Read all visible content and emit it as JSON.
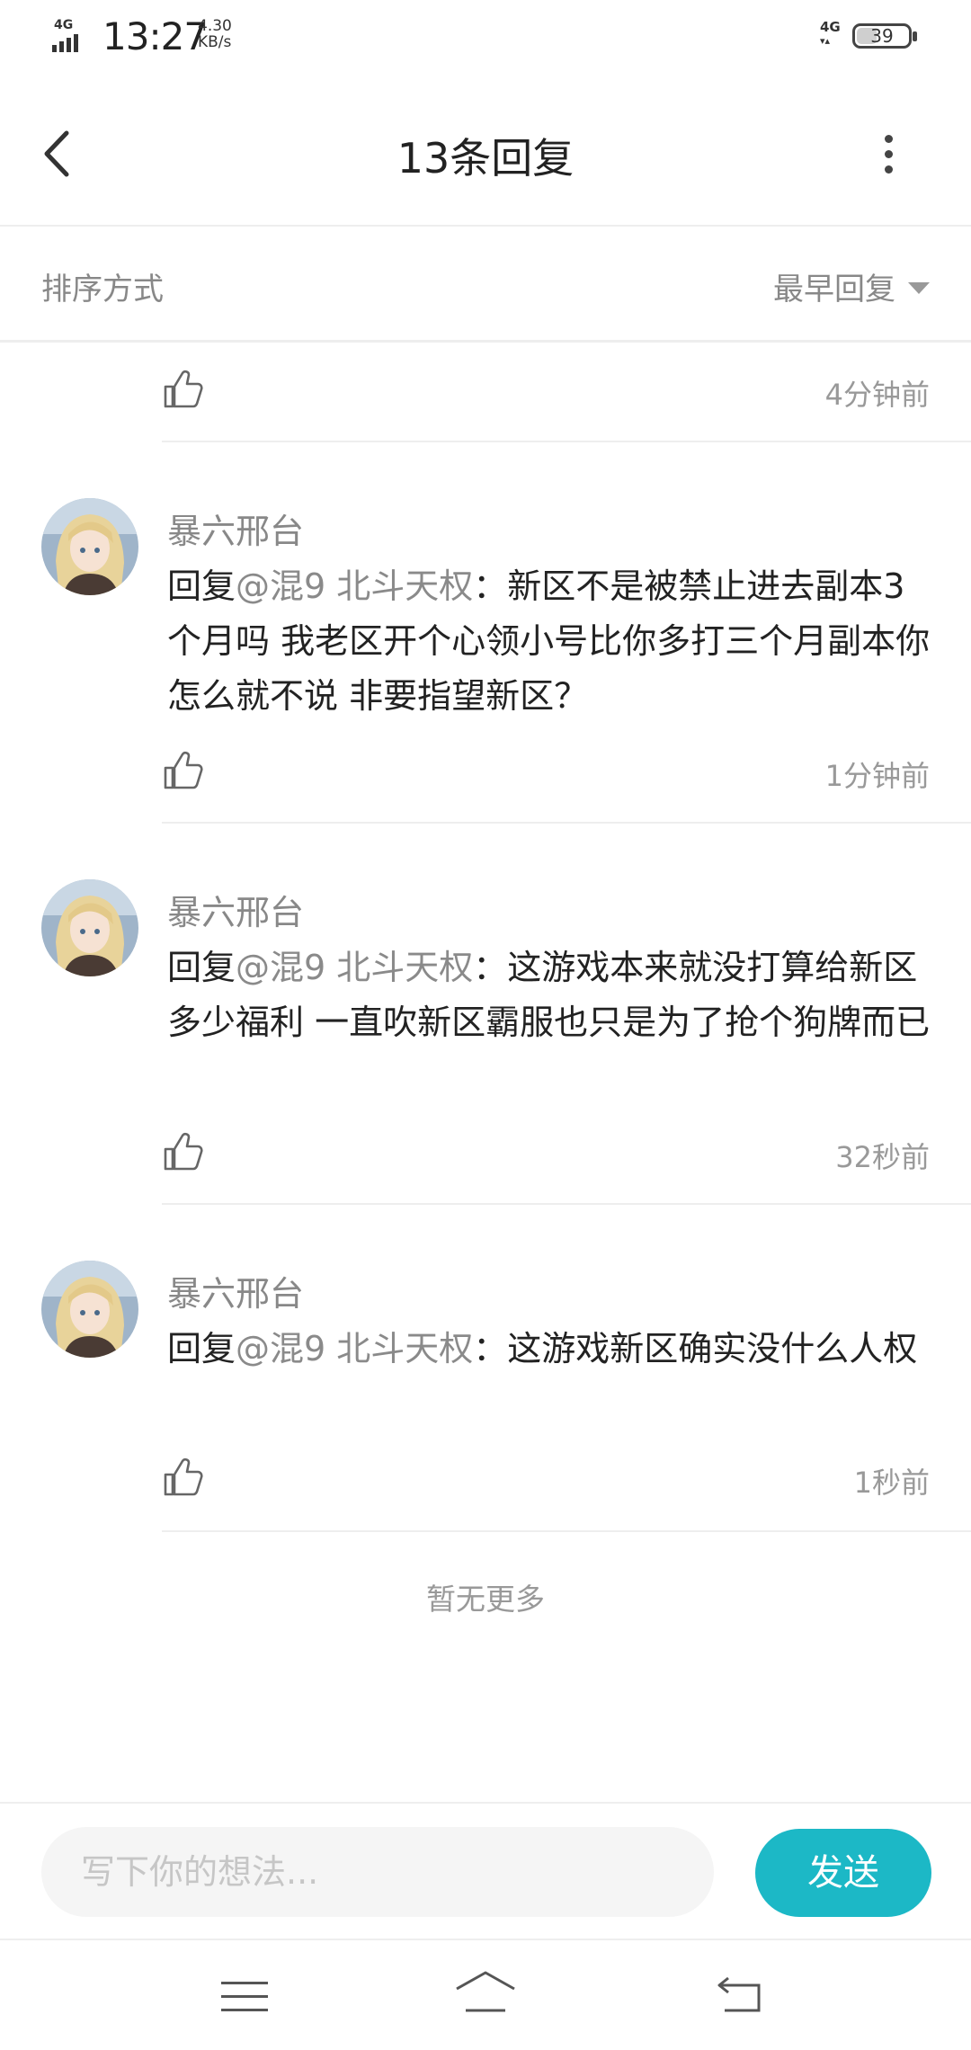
{
  "status_bar": {
    "network_left": "4G",
    "time": "13:27",
    "speed_value": "4.30",
    "speed_unit": "KB/s",
    "network_right": "4G",
    "battery_level": "39"
  },
  "header": {
    "title": "13条回复"
  },
  "sort": {
    "label": "排序方式",
    "value": "最早回复"
  },
  "partial_item": {
    "time": "4分钟前"
  },
  "comments": [
    {
      "author": "暴六邢台",
      "reply_prefix": "回复",
      "mention": "@混9 北斗天权",
      "text": "：新区不是被禁止进去副本3个月吗   我老区开个心领小号比你多打三个月副本你怎么就不说   非要指望新区？",
      "time": "1分钟前"
    },
    {
      "author": "暴六邢台",
      "reply_prefix": "回复",
      "mention": "@混9 北斗天权",
      "text": "：这游戏本来就没打算给新区多少福利   一直吹新区霸服也只是为了抢个狗牌而已",
      "time": "32秒前"
    },
    {
      "author": "暴六邢台",
      "reply_prefix": "回复",
      "mention": "@混9 北斗天权",
      "text": "：这游戏新区确实没什么人权",
      "time": "1秒前"
    }
  ],
  "footer_text": "暂无更多",
  "input": {
    "placeholder": "写下你的想法...",
    "send_label": "发送"
  },
  "colors": {
    "accent": "#1cb8c6",
    "muted_text": "#888888"
  },
  "icons": [
    "back-arrow-icon",
    "more-vertical-icon",
    "dropdown-caret-icon",
    "thumb-up-icon",
    "menu-icon",
    "home-icon",
    "back-nav-icon"
  ]
}
